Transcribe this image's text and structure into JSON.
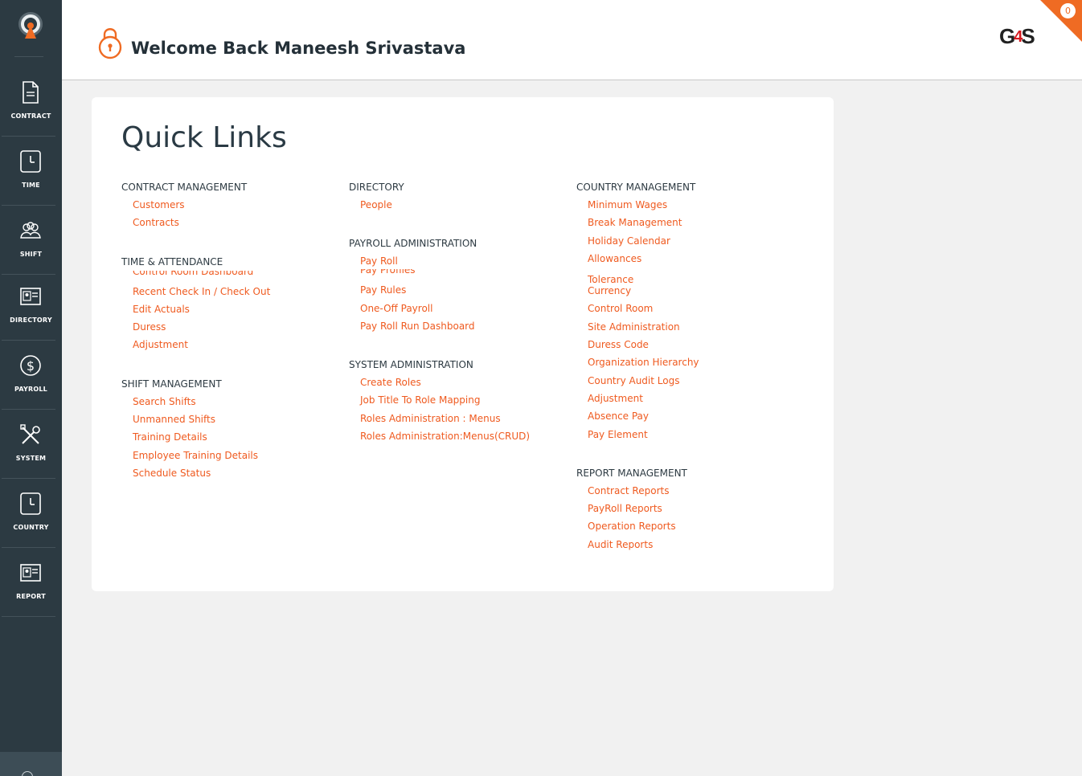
{
  "sidebar": {
    "items": [
      {
        "label": "CONTRACT",
        "icon": "document-icon"
      },
      {
        "label": "TIME",
        "icon": "clock-icon"
      },
      {
        "label": "SHIFT",
        "icon": "people-icon"
      },
      {
        "label": "DIRECTORY",
        "icon": "id-card-icon"
      },
      {
        "label": "PAYROLL",
        "icon": "dollar-icon"
      },
      {
        "label": "SYSTEM",
        "icon": "tools-icon"
      },
      {
        "label": "COUNTRY",
        "icon": "clock-icon"
      },
      {
        "label": "REPORT",
        "icon": "id-card-icon"
      }
    ]
  },
  "header": {
    "welcome": "Welcome Back Maneesh Srivastava",
    "brand_g": "G",
    "brand_4": "4",
    "brand_s": "S",
    "notification_count": "0",
    "accent_color": "#ef6b23"
  },
  "quick_links": {
    "title": "Quick Links",
    "columns": [
      [
        {
          "heading": "CONTRACT MANAGEMENT",
          "links": [
            "Customers",
            "Contracts"
          ]
        },
        {
          "heading": "TIME & ATTENDANCE",
          "links": [
            "Control Room Dashboard",
            "Recent Check In / Check Out",
            "Edit Actuals",
            "Duress",
            "Adjustment"
          ]
        },
        {
          "heading": "SHIFT MANAGEMENT",
          "links": [
            "Search Shifts",
            "Unmanned Shifts",
            "Training Details",
            "Employee Training Details",
            "Schedule Status"
          ]
        }
      ],
      [
        {
          "heading": "DIRECTORY",
          "links": [
            "People"
          ]
        },
        {
          "heading": "PAYROLL ADMINISTRATION",
          "links": [
            "Pay Roll",
            "Pay Profiles",
            "Pay Rules",
            "One-Off Payroll",
            "Pay Roll Run Dashboard"
          ]
        },
        {
          "heading": "SYSTEM ADMINISTRATION",
          "links": [
            "Create Roles",
            "Job Title To Role Mapping",
            "Roles Administration : Menus",
            "Roles Administration:Menus(CRUD)"
          ]
        }
      ],
      [
        {
          "heading": "COUNTRY MANAGEMENT",
          "links": [
            "Minimum Wages",
            "Break Management",
            "Holiday Calendar",
            "Allowances",
            "Tolerance",
            "Currency",
            "Control Room",
            "Site Administration",
            "Duress Code",
            "Organization Hierarchy",
            "Country Audit Logs",
            "Adjustment",
            "Absence Pay",
            "Pay Element"
          ]
        },
        {
          "heading": "REPORT MANAGEMENT",
          "links": [
            "Contract Reports",
            "PayRoll Reports",
            "Operation Reports",
            "Audit Reports"
          ]
        }
      ]
    ]
  }
}
